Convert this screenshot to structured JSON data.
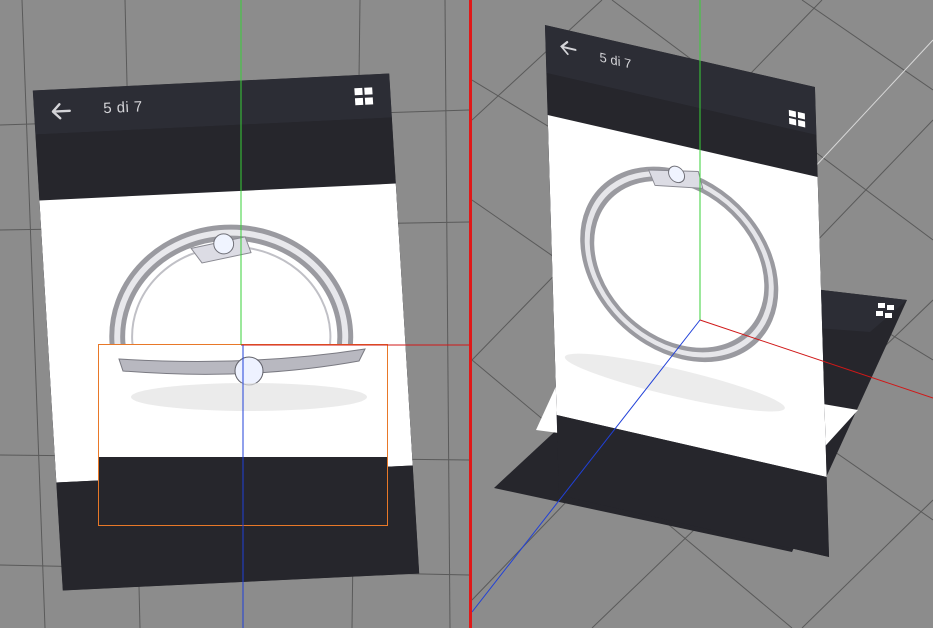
{
  "app": {
    "title": ""
  },
  "viewer": {
    "counter_text": "5 di 7",
    "back_icon": "arrow-left-icon",
    "gallery_icon": "grid-2x2-icon"
  },
  "viewer_card": {
    "gallery_icon": "grid-2x2-icon"
  },
  "colors": {
    "viewport_bg": "#8c8c8c",
    "grid_line": "#5a5a5a",
    "viewport_divider": "#e01818",
    "axis_x": "#d01818",
    "axis_y": "#38d038",
    "axis_z": "#2040d8",
    "selection_outline": "#e87828",
    "app_header": "#2c2d35",
    "app_dark": "#26262c",
    "image_bg": "#ffffff",
    "text_light": "#d4d4d8"
  }
}
